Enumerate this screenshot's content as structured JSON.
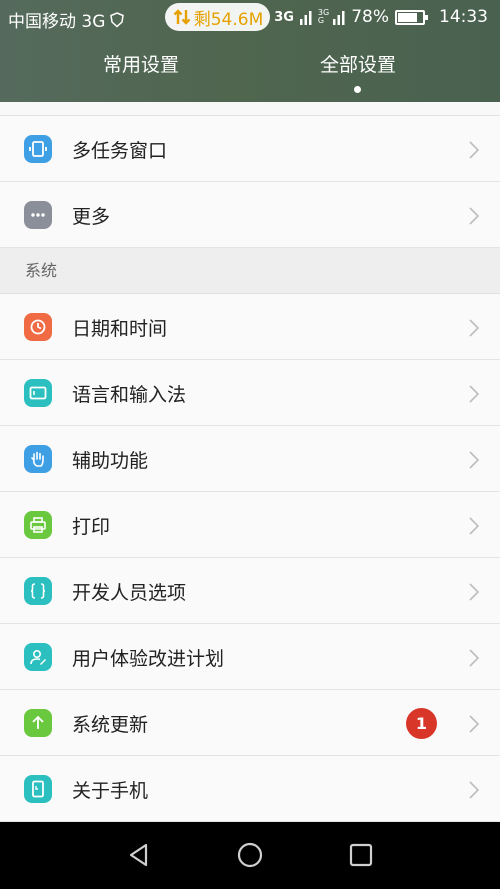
{
  "status_bar": {
    "carrier": "中国移动 3G",
    "data_remaining": "剩54.6M",
    "net_a": "3G",
    "net_b_top": "3G",
    "net_b_bottom": "G",
    "battery_percent": "78%",
    "battery_level": 0.78,
    "time": "14:33"
  },
  "tabs": [
    {
      "label": "常用设置",
      "selected": false
    },
    {
      "label": "全部设置",
      "selected": true
    }
  ],
  "top_items": [
    {
      "label": "多任务窗口",
      "icon": "multi-window-icon",
      "color": "#3f9fe5"
    },
    {
      "label": "更多",
      "icon": "more-dots-icon",
      "color": "#8a8f99"
    }
  ],
  "section_header": "系统",
  "system_items": [
    {
      "label": "日期和时间",
      "icon": "clock-icon",
      "color": "#f06a43"
    },
    {
      "label": "语言和输入法",
      "icon": "keyboard-icon",
      "color": "#2bbfbf"
    },
    {
      "label": "辅助功能",
      "icon": "hand-icon",
      "color": "#3f9fe5"
    },
    {
      "label": "打印",
      "icon": "printer-icon",
      "color": "#6ac83e"
    },
    {
      "label": "开发人员选项",
      "icon": "braces-icon",
      "color": "#2bbfbf"
    },
    {
      "label": "用户体验改进计划",
      "icon": "user-edit-icon",
      "color": "#2bbfbf"
    },
    {
      "label": "系统更新",
      "icon": "up-arrow-icon",
      "color": "#6ac83e",
      "badge": "1"
    },
    {
      "label": "关于手机",
      "icon": "phone-icon",
      "color": "#2bbfbf"
    }
  ]
}
